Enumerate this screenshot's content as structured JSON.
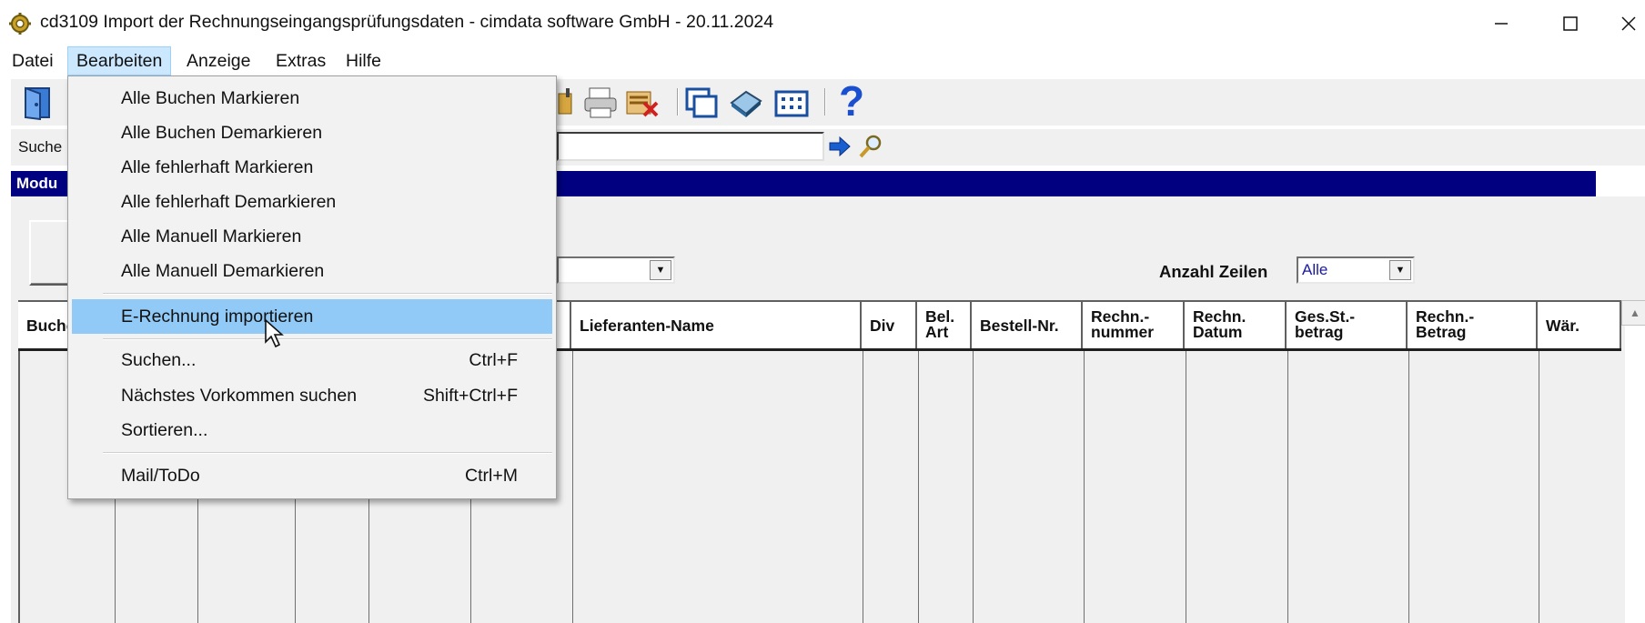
{
  "window": {
    "title": "cd3109 Import der Rechnungseingangsprüfungsdaten  - cimdata software GmbH - 20.11.2024",
    "controls": {
      "minimize": "–",
      "maximize": "☐",
      "close": "✕"
    }
  },
  "menubar": {
    "items": [
      {
        "label": "Datei"
      },
      {
        "label": "Bearbeiten",
        "active": true
      },
      {
        "label": "Anzeige"
      },
      {
        "label": "Extras"
      },
      {
        "label": "Hilfe"
      }
    ]
  },
  "toolbar": {
    "icons": [
      "exit-door-icon",
      "folder-icon",
      "printer-icon",
      "delete-list-icon",
      "windows-icon",
      "book-icon",
      "grid-icon",
      "help-icon"
    ],
    "help_glyph": "?"
  },
  "search": {
    "label": "Suche",
    "value": ""
  },
  "modul_bar": {
    "label": "Modu"
  },
  "filter": {
    "rows_label": "Anzahl Zeilen",
    "rows_value": "Alle"
  },
  "grid": {
    "columns": [
      {
        "label": "Buchen"
      },
      {
        "label": ""
      },
      {
        "label": ""
      },
      {
        "label": ""
      },
      {
        "label": ""
      },
      {
        "label": ""
      },
      {
        "label": "Lieferanten-Name"
      },
      {
        "label": "Div"
      },
      {
        "label": "Bel.\nArt"
      },
      {
        "label": "Bestell-Nr."
      },
      {
        "label": "Rechn.-\nnummer"
      },
      {
        "label": "Rechn.\nDatum"
      },
      {
        "label": "Ges.St.-\nbetrag"
      },
      {
        "label": "Rechn.-\nBetrag"
      },
      {
        "label": "Wär."
      }
    ]
  },
  "dropdown": {
    "items": [
      {
        "label": "Alle Buchen Markieren",
        "shortcut": ""
      },
      {
        "label": "Alle Buchen Demarkieren",
        "shortcut": ""
      },
      {
        "label": "Alle fehlerhaft Markieren",
        "shortcut": ""
      },
      {
        "label": "Alle fehlerhaft Demarkieren",
        "shortcut": ""
      },
      {
        "label": "Alle Manuell Markieren",
        "shortcut": ""
      },
      {
        "label": "Alle Manuell Demarkieren",
        "shortcut": ""
      },
      {
        "label": "E-Rechnung importieren",
        "shortcut": "",
        "hover": true
      },
      {
        "label": "Suchen...",
        "shortcut": "Ctrl+F"
      },
      {
        "label": "Nächstes Vorkommen suchen",
        "shortcut": "Shift+Ctrl+F"
      },
      {
        "label": "Sortieren...",
        "shortcut": ""
      },
      {
        "label": "Mail/ToDo",
        "shortcut": "Ctrl+M"
      }
    ]
  },
  "colors": {
    "modul_bar": "#000080",
    "menu_hover": "#91c9f7",
    "menu_active": "#cce8ff"
  }
}
